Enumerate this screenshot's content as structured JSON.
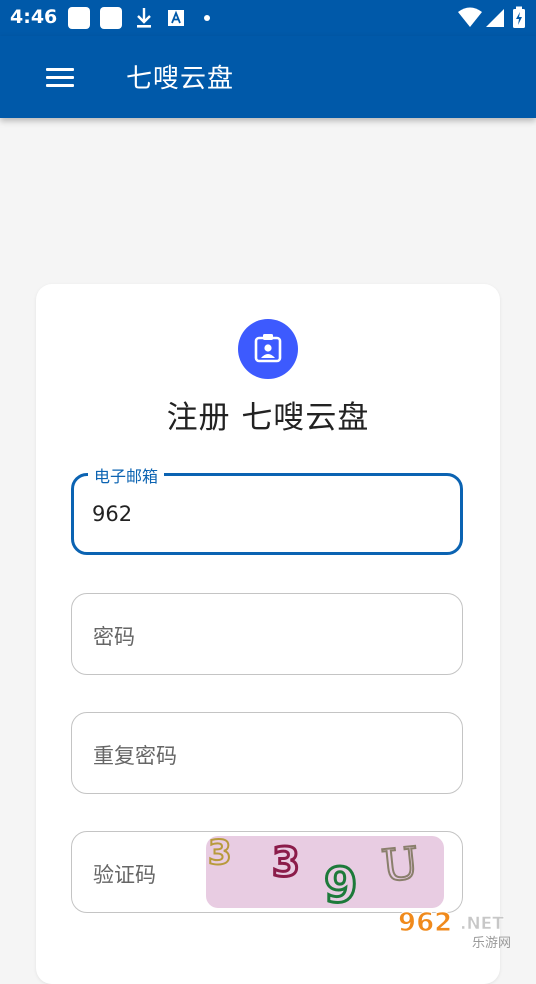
{
  "status_bar": {
    "time": "4:46"
  },
  "app_bar": {
    "title": "七嗖云盘",
    "menu_icon": "hamburger-menu-icon"
  },
  "card": {
    "avatar_icon": "contact-badge-icon",
    "title": "注册 七嗖云盘",
    "fields": {
      "email": {
        "label": "电子邮箱",
        "value": "962"
      },
      "password": {
        "placeholder": "密码"
      },
      "confirm_password": {
        "placeholder": "重复密码"
      },
      "captcha": {
        "placeholder": "验证码",
        "image_text": "339U"
      }
    }
  },
  "watermark": {
    "brand": "962.NET",
    "sub": "乐游网"
  },
  "colors": {
    "primary": "#0059a9",
    "accent": "#3d5afe",
    "focus": "#0b63b2"
  }
}
